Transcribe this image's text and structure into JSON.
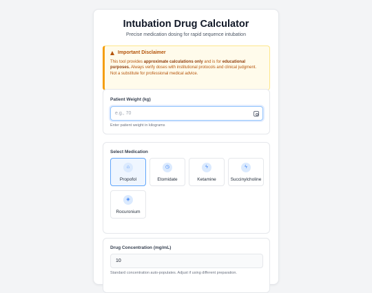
{
  "header": {
    "title": "Intubation Drug Calculator",
    "subtitle": "Precise medication dosing for rapid sequence intubation"
  },
  "disclaimer": {
    "title": "Important Disclaimer",
    "text_1": "This tool provides ",
    "bold_1": "approximate calculations only",
    "text_2": " and is for ",
    "bold_2": "educational purposes.",
    "text_3": " Always verify doses with institutional protocols and clinical judgment. Not a substitute for professional medical advice."
  },
  "weight": {
    "label": "Patient Weight (kg)",
    "placeholder": "e.g., 70",
    "help": "Enter patient weight in kilograms",
    "icon": "scale-icon"
  },
  "medication": {
    "label": "Select Medication",
    "items": [
      {
        "name": "Propofol",
        "icon": "syringe-icon",
        "glyph": "⌂",
        "selected": true
      },
      {
        "name": "Etomidate",
        "icon": "clock-icon",
        "glyph": "◷",
        "selected": false
      },
      {
        "name": "Ketamine",
        "icon": "bolt-icon",
        "glyph": "ϟ",
        "selected": false
      },
      {
        "name": "Succinylcholine",
        "icon": "bolt-icon",
        "glyph": "ϟ",
        "selected": false
      },
      {
        "name": "Rocuronium",
        "icon": "cube-icon",
        "glyph": "◈",
        "selected": false
      }
    ]
  },
  "concentration": {
    "label": "Drug Concentration (mg/mL)",
    "value": "10",
    "help": "Standard concentration auto-populates. Adjust if using different preparation."
  },
  "colors": {
    "accent": "#3b82f6",
    "warning": "#b45309",
    "warning_bg": "#fffbeb"
  }
}
